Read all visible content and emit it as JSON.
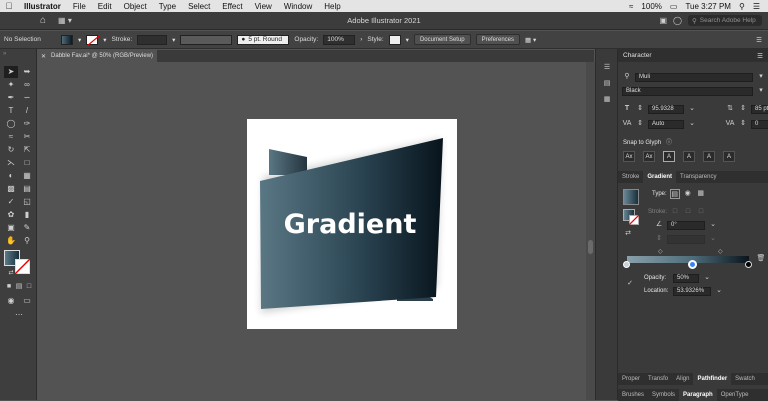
{
  "menubar": {
    "apple": "",
    "items": [
      "Illustrator",
      "File",
      "Edit",
      "Object",
      "Type",
      "Select",
      "Effect",
      "View",
      "Window",
      "Help"
    ],
    "battery": "100%",
    "clock": "Tue 3:27 PM"
  },
  "appbar": {
    "title": "Adobe Illustrator 2021",
    "search_placeholder": "Search Adobe Help"
  },
  "control": {
    "no_selection": "No Selection",
    "stroke_label": "Stroke:",
    "brush_label": "5 pt. Round",
    "opacity_label": "Opacity:",
    "opacity_value": "100%",
    "style_label": "Style:",
    "document_setup": "Document Setup",
    "preferences": "Preferences"
  },
  "document": {
    "tab_label": "Dabble Fav.ai* @ 50% (RGB/Preview)",
    "art_text": "Gradient"
  },
  "character": {
    "header": "Character",
    "font_family": "Muli",
    "font_style": "Black",
    "font_size": "95.9328",
    "leading": "85 pt",
    "kerning": "Auto",
    "tracking": "0",
    "snap_label": "Snap to Glyph"
  },
  "gradient": {
    "tabs": [
      "Stroke",
      "Gradient",
      "Transparency"
    ],
    "type_label": "Type:",
    "stroke_label": "Stroke:",
    "angle": "0°",
    "opacity_label": "Opacity:",
    "opacity_value": "50%",
    "location_label": "Location:",
    "location_value": "53.9326%"
  },
  "bottom_tabs_1": [
    "Proper",
    "Transfo",
    "Align",
    "Pathfinder",
    "Swatch"
  ],
  "bottom_tabs_2": [
    "Brushes",
    "Symbols",
    "Paragraph",
    "OpenType"
  ],
  "colors": {
    "gradient_start": "#4f6b78",
    "gradient_end": "#0a1a25",
    "accent_stop": "#3b82f6"
  }
}
